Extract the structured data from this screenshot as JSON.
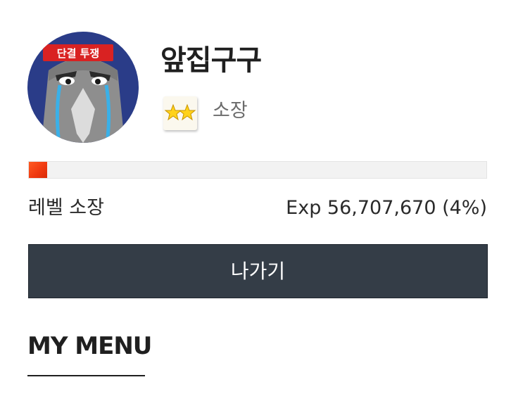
{
  "profile": {
    "nickname": "앞집구구",
    "avatar_banner_text": "단결 투쟁",
    "rank_icon": "two-stars-icon",
    "rank_label": "소장"
  },
  "level": {
    "label": "레벨 소장",
    "exp_text": "Exp 56,707,670 (4%)",
    "progress_percent": 4,
    "progress_color": "#f03a10"
  },
  "actions": {
    "exit_label": "나가기",
    "exit_color": "#343d47"
  },
  "menu": {
    "title": "MY MENU"
  }
}
